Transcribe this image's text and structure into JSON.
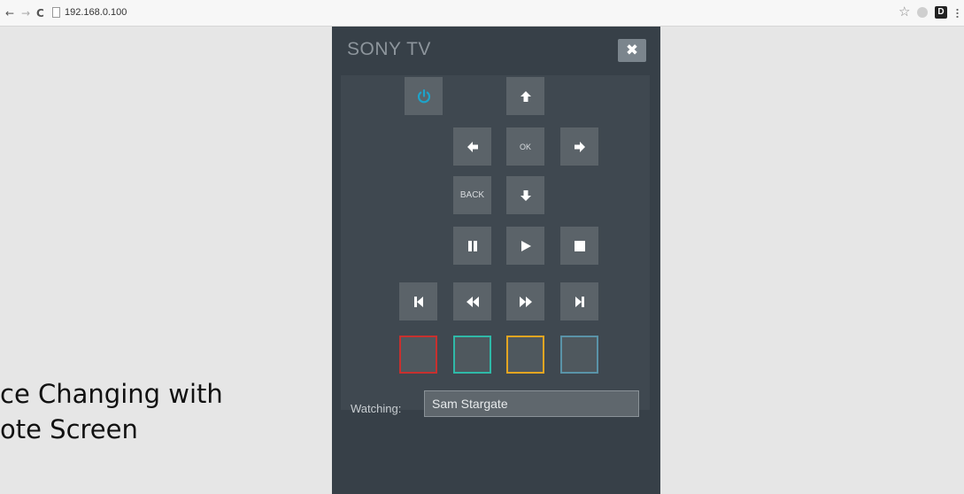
{
  "browser": {
    "back_glyph": "←",
    "forward_glyph": "→",
    "reload_glyph": "C",
    "url": "192.168.0.100",
    "star_glyph": "☆",
    "ext_label": "D"
  },
  "caption": {
    "line1": "ce Changing with",
    "line2": "ote Screen"
  },
  "remote": {
    "title": "SONY TV",
    "close_glyph": "✖",
    "ok_label": "OK",
    "back_label": "BACK",
    "colors": {
      "panel_bg": "#374048",
      "button_bg": "#5b6369",
      "power_icon": "#1ea3c9",
      "red": "#c8302e",
      "teal": "#2fb9a8",
      "yellow": "#e3a521",
      "blue": "#5a93a8"
    },
    "watching_label": "Watching:",
    "watching_value": "Sam Stargate"
  },
  "icons": [
    "power-icon",
    "arrow-up-icon",
    "arrow-left-icon",
    "arrow-right-icon",
    "arrow-down-icon",
    "pause-icon",
    "play-icon",
    "stop-icon",
    "skip-previous-icon",
    "rewind-icon",
    "fast-forward-icon",
    "skip-next-icon",
    "close-icon",
    "star-icon"
  ]
}
